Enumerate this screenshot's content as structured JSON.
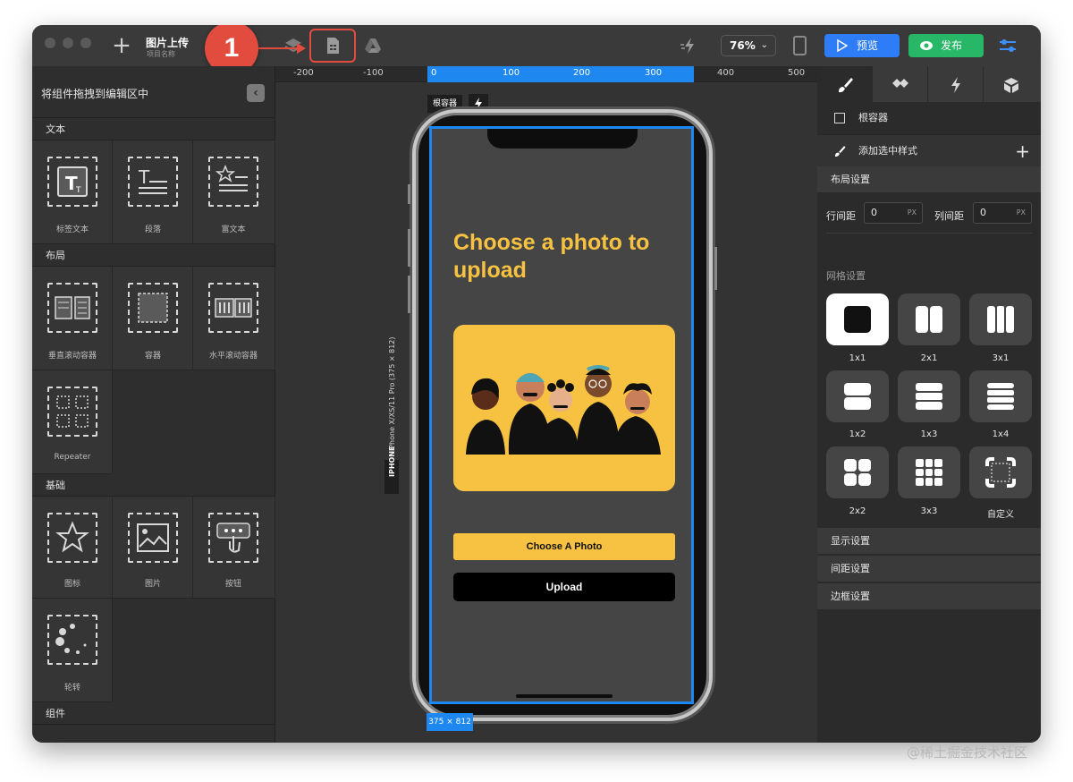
{
  "app": {
    "project_title": "图片上传",
    "project_subtitle": "项目名称",
    "zoom": "76%",
    "preview_label": "预览",
    "publish_label": "发布"
  },
  "annotation": {
    "marker": "1",
    "color": "#e24c3e"
  },
  "left_panel": {
    "header": "将组件拖拽到编辑区中",
    "sections": {
      "text": "文本",
      "layout": "布局",
      "basic": "基础",
      "components": "组件"
    },
    "text_items": [
      {
        "label": "标签文本",
        "icon": "label-text-icon"
      },
      {
        "label": "段落",
        "icon": "paragraph-icon"
      },
      {
        "label": "富文本",
        "icon": "rich-text-icon"
      }
    ],
    "layout_items": [
      {
        "label": "垂直滚动容器",
        "icon": "vertical-scroll-container-icon"
      },
      {
        "label": "容器",
        "icon": "container-icon"
      },
      {
        "label": "水平滚动容器",
        "icon": "horizontal-scroll-container-icon"
      },
      {
        "label": "Repeater",
        "icon": "repeater-icon"
      }
    ],
    "basic_items": [
      {
        "label": "图标",
        "icon": "star-icon"
      },
      {
        "label": "图片",
        "icon": "image-icon"
      },
      {
        "label": "按钮",
        "icon": "button-icon"
      },
      {
        "label": "轮转",
        "icon": "spinner-icon"
      }
    ]
  },
  "canvas": {
    "ruler": [
      "-200",
      "-100",
      "0",
      "100",
      "200",
      "300",
      "400",
      "500"
    ],
    "root_tag": "根容器",
    "device_name": "iPhone X/XS/11 Pro (375 × 812)",
    "device_badge": "IPHONE",
    "size_tag": "375 × 812",
    "accent": "#1e88f0"
  },
  "screen": {
    "title": "Choose a photo to upload",
    "choose_button": "Choose A Photo",
    "upload_button": "Upload",
    "accent": "#f7c241",
    "background": "#454545"
  },
  "right_panel": {
    "root_container": "根容器",
    "add_style": "添加选中样式",
    "layout_settings": "布局设置",
    "row_gap_label": "行间距",
    "row_gap_value": "0",
    "col_gap_label": "列间距",
    "col_gap_value": "0",
    "unit": "PX",
    "grid_settings": "网格设置",
    "grid_options": [
      "1x1",
      "2x1",
      "3x1",
      "1x2",
      "1x3",
      "1x4",
      "2x2",
      "3x3",
      "自定义"
    ],
    "display_settings": "显示设置",
    "spacing_settings": "间距设置",
    "border_settings": "边框设置"
  },
  "watermark": "@稀土掘金技术社区"
}
